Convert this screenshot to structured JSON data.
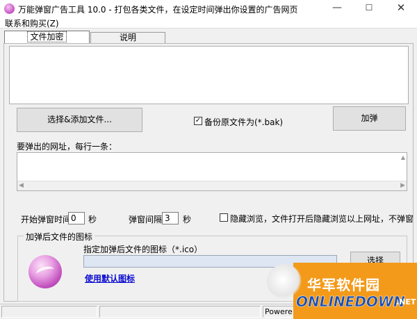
{
  "window": {
    "title": "万能弹窗广告工具 10.0 - 打包各类文件，在设定时间弹出你设置的广告网页",
    "min_glyph": "—",
    "max_glyph": "☐",
    "close_glyph": "✕"
  },
  "menu": {
    "contact": "联系和购买(Z)"
  },
  "tabs": [
    {
      "label": "文件加密",
      "active": true
    },
    {
      "label": "说明",
      "active": false
    }
  ],
  "main": {
    "add_button": "选择&添加文件...",
    "backup_checked": "✓",
    "backup_label": "备份原文件为(*.bak)",
    "pop_button": "加弹",
    "url_label": "要弹出的网址，每行一条：",
    "start_label": "开始弹窗时间",
    "start_value": "0",
    "sec_label_1": "秒",
    "interval_label": "弹窗间隔",
    "interval_value": "3",
    "sec_label_2": "秒",
    "hide_label": "隐藏浏览，文件打开后隐藏浏览以上网址，不弹窗"
  },
  "icon_group": {
    "title": "加弹后文件的图标",
    "spec_label": "指定加弹后文件的图标（*.ico）",
    "choose_button": "选择",
    "default_link": "使用默认图标"
  },
  "status": {
    "seg3": "Powere"
  },
  "watermark": {
    "cn": "华军软件园",
    "en": "ONLINEDOWN",
    "tld": ".NET"
  },
  "colors": {
    "link": "#0b0bd0",
    "watermark_orange": "#f39a1a",
    "watermark_blue": "#1a4fb0"
  }
}
